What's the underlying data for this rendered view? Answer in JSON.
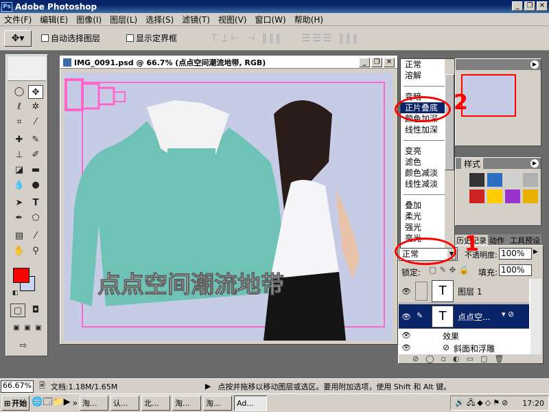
{
  "app": {
    "title": "Adobe Photoshop",
    "logo": "Ps"
  },
  "window_controls": {
    "minimize": "_",
    "restore": "❐",
    "close": "✕"
  },
  "menu": [
    "文件(F)",
    "编辑(E)",
    "图像(I)",
    "图层(L)",
    "选择(S)",
    "滤镜(T)",
    "视图(V)",
    "窗口(W)",
    "帮助(H)"
  ],
  "options": {
    "auto_select": "自动选择图层",
    "show_bounds": "显示定界框"
  },
  "document": {
    "title": "IMG_0091.psd @ 66.7% (点点空间潮流地带, RGB)",
    "canvas_text": "点点空间潮流地带"
  },
  "blend_modes": {
    "group1": [
      "正常",
      "溶解"
    ],
    "group2": [
      "变暗",
      "正片叠底",
      "颜色加深",
      "线性加深"
    ],
    "group3": [
      "变亮",
      "滤色",
      "颜色减淡",
      "线性减淡"
    ],
    "group4": [
      "叠加",
      "柔光",
      "强光",
      "亮光"
    ],
    "selected": "正片叠底"
  },
  "annotations": {
    "step1": "1",
    "step2": "2"
  },
  "styles_panel": {
    "tab": "样式"
  },
  "history_tabs": [
    "历史记录",
    "动作",
    "工具预设"
  ],
  "layers_panel": {
    "blend_mode": "正常",
    "opacity_label": "不透明度:",
    "opacity": "100%",
    "lock_label": "锁定:",
    "fill_label": "填充:",
    "fill": "100%",
    "layers": [
      {
        "name": "图层 1",
        "thumb": "T"
      },
      {
        "name": "点点空...",
        "thumb": "T"
      }
    ],
    "effects_label": "效果",
    "effect": "斜面和浮雕"
  },
  "statusbar": {
    "zoom": "66.67%",
    "doc": "文档:1.18M/1.65M",
    "hint": "点按并拖移以移动图层或选区。要用附加选项，使用 Shift 和 Alt 键。"
  },
  "taskbar": {
    "start": "开始",
    "items": [
      "淘...",
      "认...",
      "北...",
      "淘...",
      "淘...",
      "Ad..."
    ],
    "clock": "17:20"
  },
  "colors": {
    "foreground": "#ff0000",
    "background": "#c8d4f0",
    "highlight_circle": "#ff0000"
  }
}
